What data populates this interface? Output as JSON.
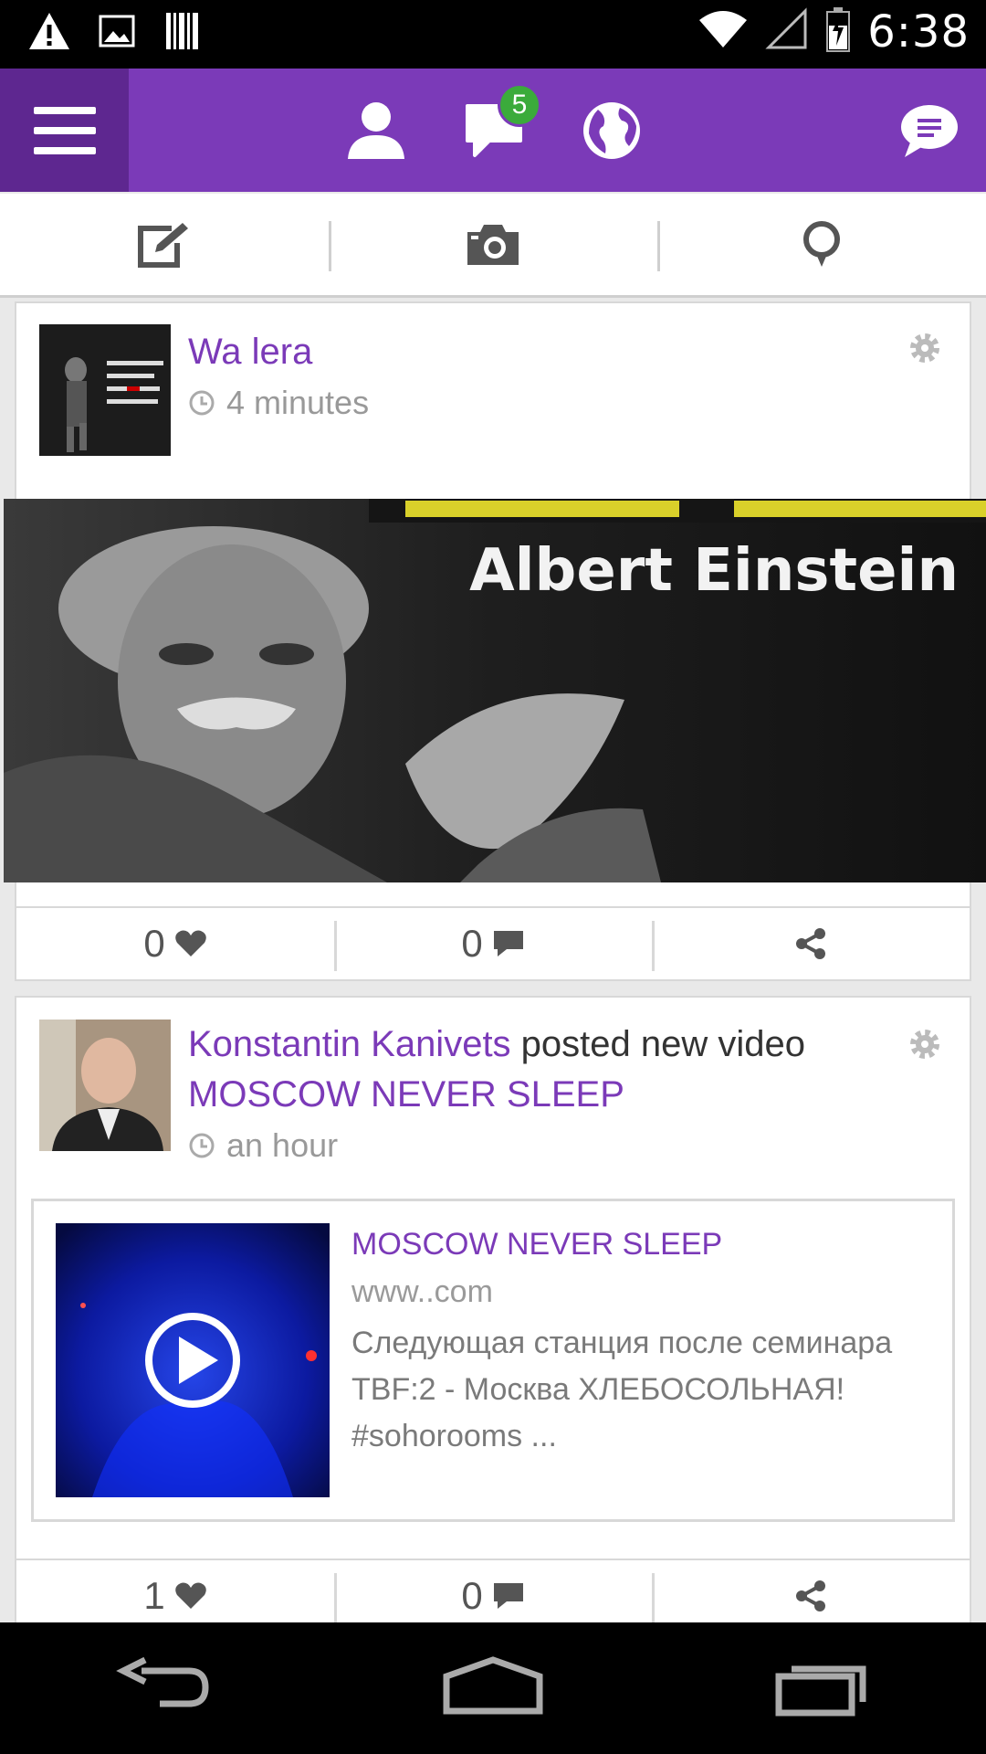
{
  "status_bar": {
    "time": "6:38",
    "icons": [
      "warning-icon",
      "image-icon",
      "barcode-icon",
      "wifi-icon",
      "signal-icon",
      "battery-icon"
    ]
  },
  "app_bar": {
    "accent": "#7b3ab8",
    "dark_accent": "#5e2790",
    "message_badge": "5",
    "icons": [
      "menu-icon",
      "profile-icon",
      "messages-icon",
      "globe-icon",
      "chat-icon"
    ]
  },
  "composer": {
    "tools": [
      "status-edit-icon",
      "camera-icon",
      "location-icon"
    ]
  },
  "posts": [
    {
      "author": "Wa lera",
      "time": "4 minutes",
      "image_caption": "Albert Einstein",
      "likes": "0",
      "comments": "0"
    },
    {
      "author": "Konstantin Kanivets",
      "action": " posted new video",
      "video_title": "MOSCOW NEVER SLEEP",
      "time": "an hour",
      "link": {
        "title": "MOSCOW NEVER SLEEP",
        "url": "www..com",
        "description": "Следующая станция после семинара TBF:2 - Москва ХЛЕБОСОЛЬНАЯ! #sohorooms ..."
      },
      "likes": "1",
      "comments": "0"
    }
  ]
}
